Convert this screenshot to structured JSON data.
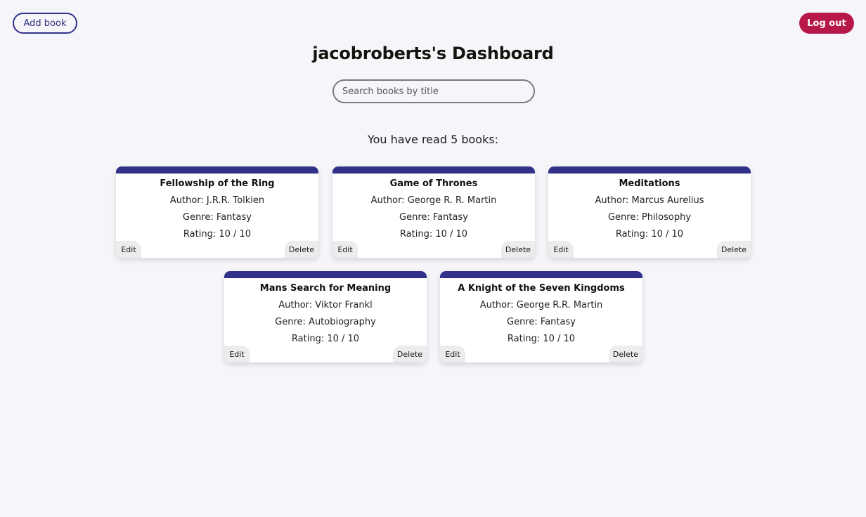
{
  "header": {
    "add_book_label": "Add book",
    "logout_label": "Log out",
    "title": "jacobroberts's Dashboard"
  },
  "search": {
    "placeholder": "Search books by title"
  },
  "summary": "You have read 5 books:",
  "books": [
    {
      "title": "Fellowship of the Ring",
      "author": "Author: J.R.R. Tolkien",
      "genre": "Genre: Fantasy",
      "rating": "Rating: 10 / 10",
      "edit_label": "Edit",
      "delete_label": "Delete"
    },
    {
      "title": "Game of Thrones",
      "author": "Author: George R. R. Martin",
      "genre": "Genre: Fantasy",
      "rating": "Rating: 10 / 10",
      "edit_label": "Edit",
      "delete_label": "Delete"
    },
    {
      "title": "Meditations",
      "author": "Author: Marcus Aurelius",
      "genre": "Genre: Philosophy",
      "rating": "Rating: 10 / 10",
      "edit_label": "Edit",
      "delete_label": "Delete"
    },
    {
      "title": "Mans Search for Meaning",
      "author": "Author: Viktor Frankl",
      "genre": "Genre: Autobiography",
      "rating": "Rating: 10 / 10",
      "edit_label": "Edit",
      "delete_label": "Delete"
    },
    {
      "title": "A Knight of the Seven Kingdoms",
      "author": "Author: George R.R. Martin",
      "genre": "Genre: Fantasy",
      "rating": "Rating: 10 / 10",
      "edit_label": "Edit",
      "delete_label": "Delete"
    }
  ],
  "colors": {
    "accent": "#31318a",
    "logout": "#b8174a",
    "background": "#f6f6fa"
  }
}
